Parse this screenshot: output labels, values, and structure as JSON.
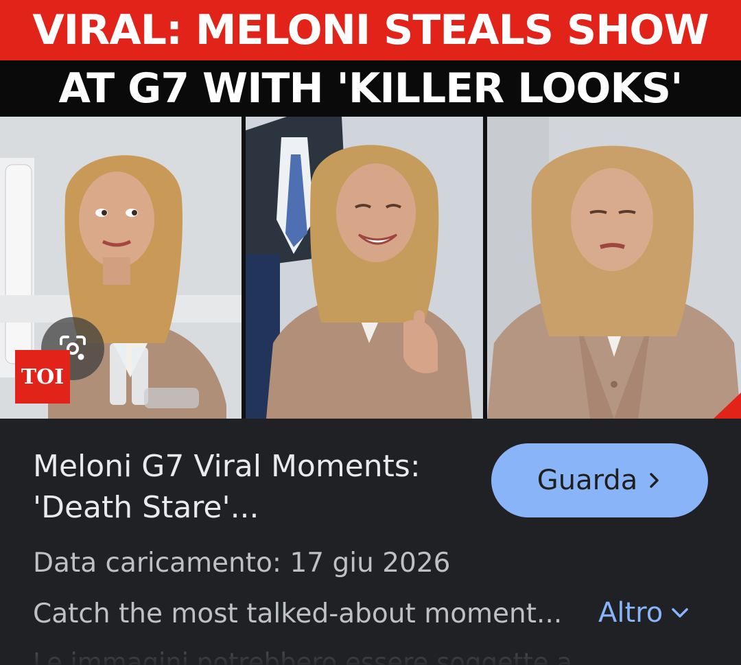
{
  "thumbnail": {
    "headline_line1": "VIRAL: MELONI STEALS SHOW",
    "headline_line2": "AT G7 WITH 'KILLER LOOKS'",
    "source_logo": "TOI",
    "lens_icon": "google-lens-icon",
    "colors": {
      "banner_red": "#e2231a",
      "banner_black": "#0a0a0a"
    }
  },
  "result": {
    "title": "Meloni G7 Viral Moments: 'Death Stare'...",
    "watch_label": "Guarda",
    "watch_icon": "chevron-right-icon",
    "upload_date": "Data caricamento: 17 giu 2026",
    "snippet": "Catch the most talked-about moment...",
    "more_label": "Altro",
    "more_icon": "chevron-down-icon",
    "disclaimer": "Le immagini potrebbero essere soggette a"
  },
  "colors": {
    "background": "#202124",
    "accent_blue": "#8ab4f8",
    "text_primary": "#e8eaed",
    "text_secondary": "#bdc1c6"
  }
}
